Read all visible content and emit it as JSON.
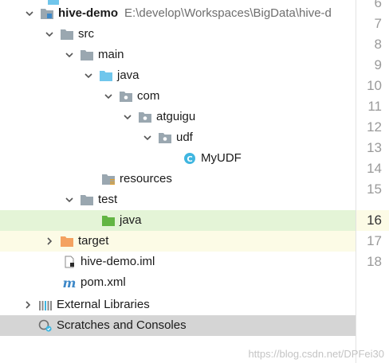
{
  "project": {
    "name": "hive-demo",
    "path": "E:\\develop\\Workspaces\\BigData\\hive-d"
  },
  "tree": {
    "src": "src",
    "main": "main",
    "main_java": "java",
    "com": "com",
    "atguigu": "atguigu",
    "udf": "udf",
    "myudf": "MyUDF",
    "resources": "resources",
    "test": "test",
    "test_java": "java",
    "target": "target",
    "iml": "hive-demo.iml",
    "pom": "pom.xml",
    "external_libraries": "External Libraries",
    "scratches": "Scratches and Consoles"
  },
  "gutter": {
    "lines": [
      "6",
      "7",
      "8",
      "9",
      "10",
      "11",
      "12",
      "13",
      "14",
      "15",
      "16",
      "17",
      "18"
    ],
    "current_line": "16"
  },
  "watermark": "https://blog.csdn.net/DPFei30",
  "colors": {
    "folder_gray": "#9aa7b0",
    "source_folder_blue": "#70c6ec",
    "test_folder_green": "#62b543",
    "excluded_folder_orange": "#f4a261",
    "class_icon_blue": "#40b6e0",
    "selection_green": "#e4f4d7",
    "current_line_yellow": "#fcfbe6",
    "selected_gray": "#d5d5d5"
  }
}
